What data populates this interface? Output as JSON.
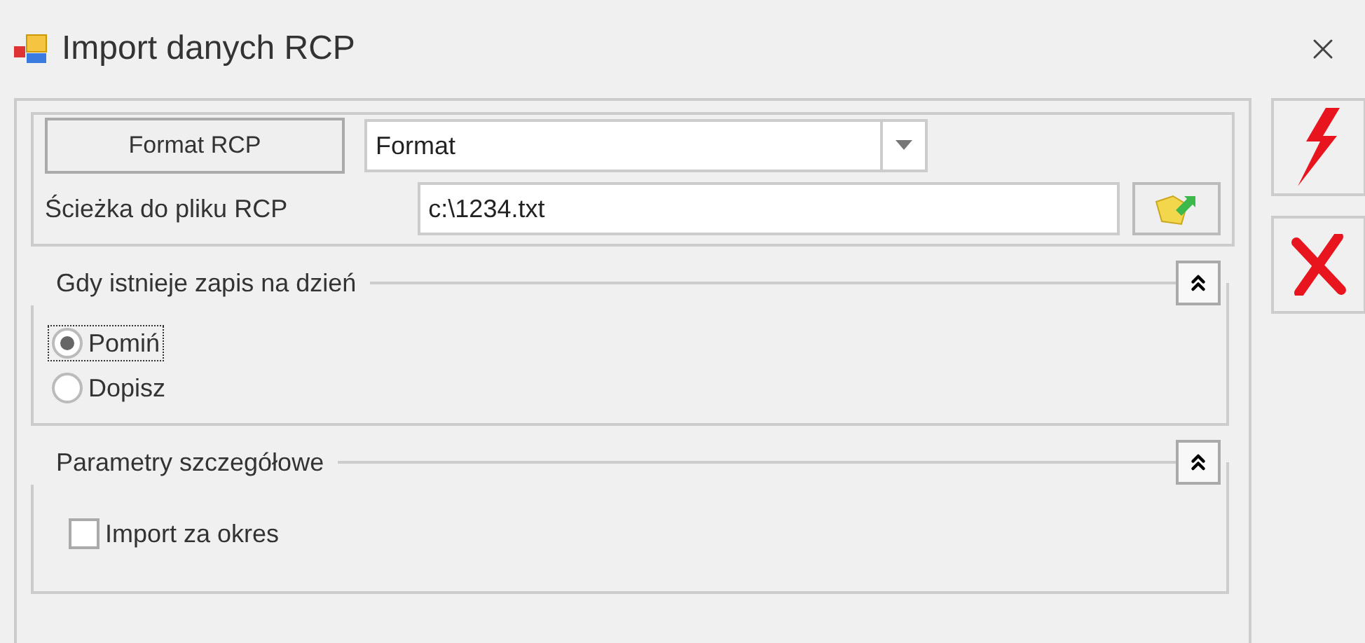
{
  "window": {
    "title": "Import danych RCP"
  },
  "format": {
    "button": "Format RCP",
    "select_value": "Format"
  },
  "path": {
    "label": "Ścieżka do pliku RCP",
    "value": "c:\\1234.txt"
  },
  "groups": [
    {
      "kind": "radios",
      "title": "Gdy istnieje zapis na dzień",
      "expanded": true,
      "options": [
        {
          "label": "Pomiń",
          "selected": true,
          "focused": true
        },
        {
          "label": "Dopisz",
          "selected": false,
          "focused": false
        }
      ]
    },
    {
      "kind": "checkbox",
      "title": "Parametry szczegółowe",
      "expanded": true,
      "label": "Import za okres",
      "checked": false
    }
  ]
}
